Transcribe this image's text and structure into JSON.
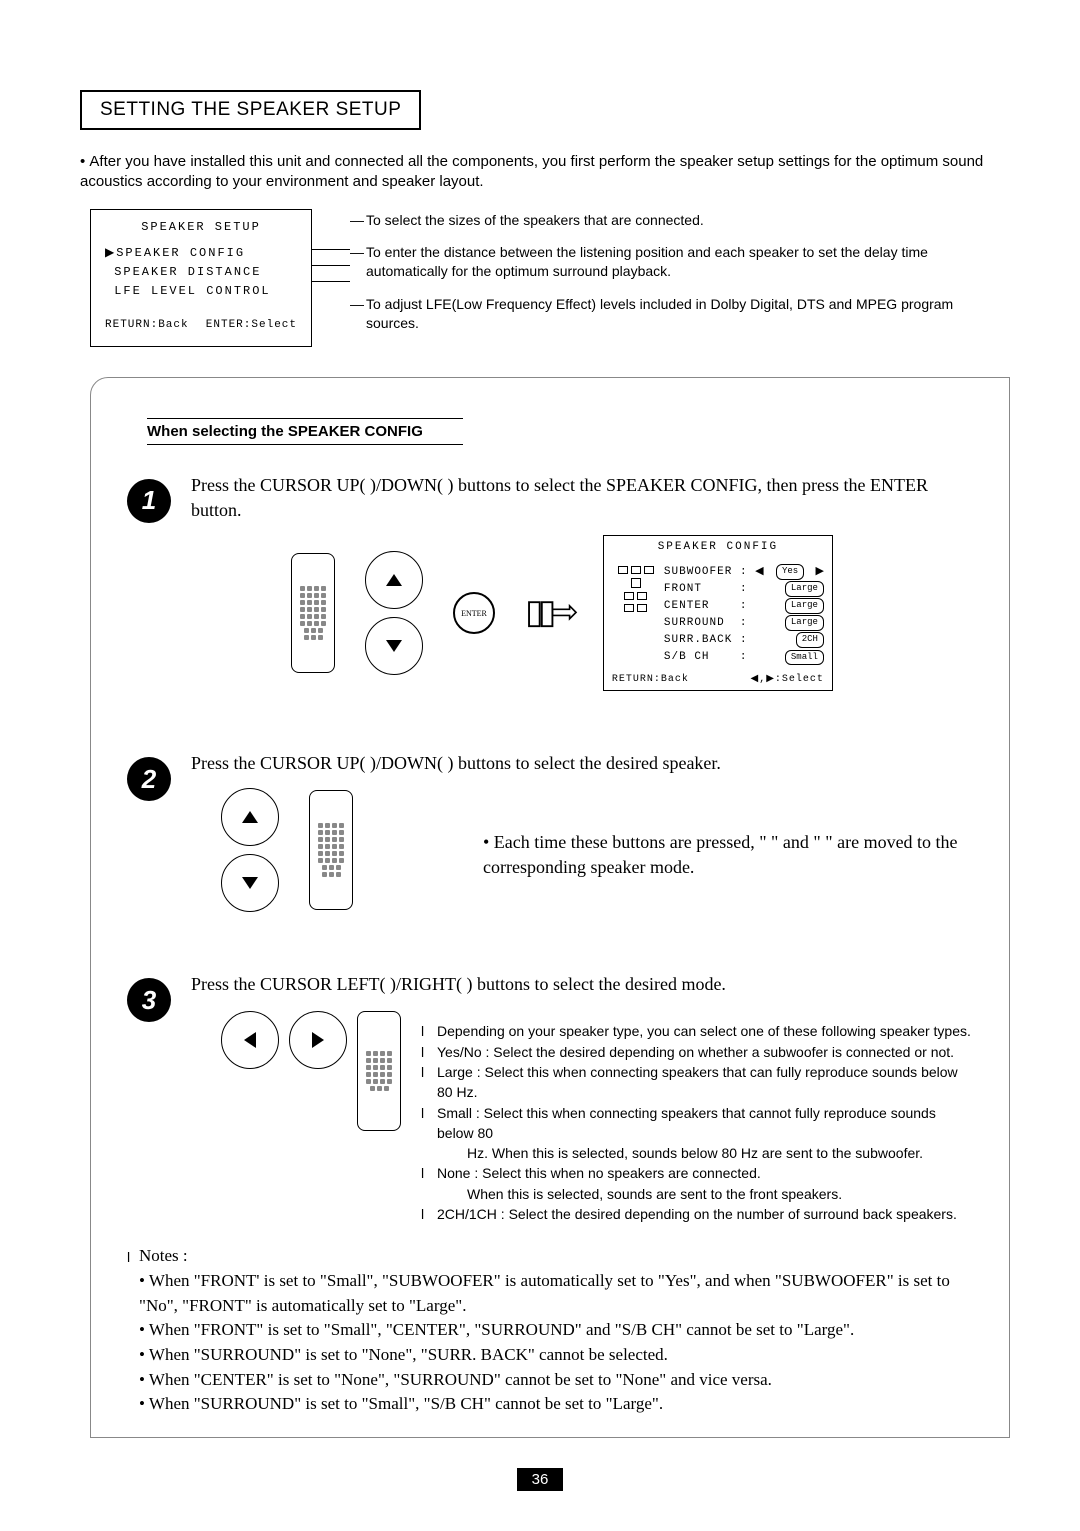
{
  "title": "SETTING THE SPEAKER SETUP",
  "intro": "After you have installed this unit and connected all the components, you first perform the speaker setup settings for the optimum sound acoustics according to your environment and speaker layout.",
  "osd1": {
    "title": "SPEAKER SETUP",
    "row1": "▶SPEAKER CONFIG",
    "row2": " SPEAKER DISTANCE",
    "row3": " LFE LEVEL CONTROL",
    "foot_left": "RETURN:Back",
    "foot_right": "ENTER:Select"
  },
  "desc": {
    "d1": "To select the sizes of the speakers that are connected.",
    "d2": "To enter the distance between the listening position and each speaker to set the delay time automatically for the optimum surround playback.",
    "d3": "To adjust LFE(Low Frequency Effect) levels included in Dolby Digital, DTS and MPEG program sources."
  },
  "sub_heading": "When selecting the SPEAKER CONFIG",
  "step1": {
    "text": "Press the CURSOR UP(    )/DOWN(    ) buttons to select the SPEAKER CONFIG, then press the ENTER button.",
    "enter": "ENTER",
    "arrow": "▯▯⇨"
  },
  "osd2": {
    "title": "SPEAKER CONFIG",
    "rows": [
      {
        "label": "SUBWOOFER",
        "val": "Yes",
        "pre": "◀",
        "post": "▶"
      },
      {
        "label": "FRONT",
        "val": "Large"
      },
      {
        "label": "CENTER",
        "val": "Large"
      },
      {
        "label": "SURROUND",
        "val": "Large"
      },
      {
        "label": "SURR.BACK",
        "val": "2CH"
      },
      {
        "label": "S/B CH",
        "val": "Small"
      }
    ],
    "foot_left": "RETURN:Back",
    "foot_right": "◀,▶:Select"
  },
  "step2": {
    "text": "Press the CURSOR UP(    )/DOWN(    ) buttons to select the desired speaker.",
    "note": "• Each time these buttons are pressed, \"    \" and \"    \" are moved to the corresponding speaker mode."
  },
  "step3": {
    "text": "Press the CURSOR LEFT(    )/RIGHT(    ) buttons to select the desired mode.",
    "exp": [
      "Depending on your speaker type, you can select one of these following speaker types.",
      "Yes/No : Select the desired depending on whether a subwoofer is connected or not.",
      "Large : Select this when connecting speakers that can fully reproduce sounds below 80 Hz.",
      "Small : Select this when connecting speakers that cannot fully reproduce sounds below 80",
      "None : Select this when no speakers are connected.",
      "2CH/1CH : Select the desired depending on the number of surround back speakers."
    ],
    "sub1": "Hz. When this is selected, sounds below 80 Hz are sent to the subwoofer.",
    "sub2": "When this is selected, sounds are sent to the front speakers."
  },
  "notes": {
    "heading": "Notes :",
    "items": [
      "When \"FRONT' is set to \"Small\", \"SUBWOOFER\" is automatically set to \"Yes\", and when \"SUBWOOFER\" is set to \"No\", \"FRONT\" is automatically set to \"Large\".",
      "When \"FRONT\" is set to \"Small\", \"CENTER\", \"SURROUND\" and \"S/B CH\" cannot be set to \"Large\".",
      "When \"SURROUND\" is set to \"None\", \"SURR. BACK\" cannot be selected.",
      "When \"CENTER\" is set to \"None\", \"SURROUND\" cannot be set to \"None\" and vice versa.",
      "When \"SURROUND\" is set to \"Small\", \"S/B CH\" cannot be set to \"Large\"."
    ]
  },
  "page_number": "36"
}
